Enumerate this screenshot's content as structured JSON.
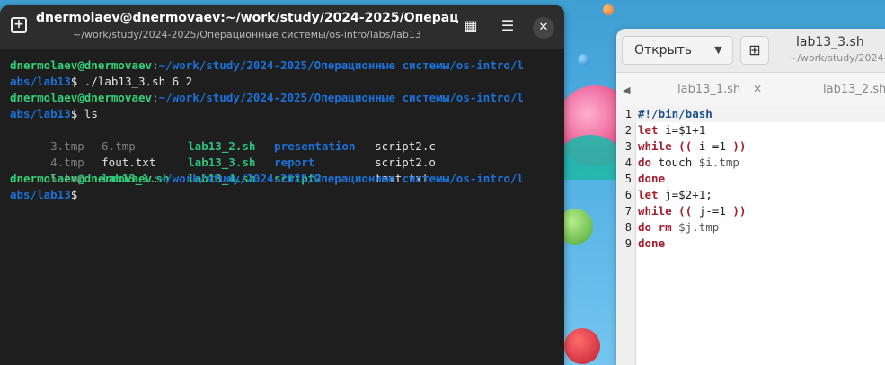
{
  "terminal": {
    "title": "dnermolaev@dnermovaev:~/work/study/2024-2025/Операц...",
    "subtitle": "~/work/study/2024-2025/Операционные системы/os-intro/labs/lab13",
    "prompt_user": "dnermolaev@dnermovaev",
    "prompt_path_1": "~/work/study/2024-2025/Операционные системы/os-intro/l",
    "prompt_path_2": "abs/lab13",
    "cmd1": " ./lab13_3.sh 6 2",
    "cmd2": " ls",
    "ls": {
      "r1": [
        "3.tmp",
        "6.tmp",
        "lab13_2.sh",
        "presentation",
        "script2.c"
      ],
      "r2": [
        "4.tmp",
        "fout.txt",
        "lab13_3.sh",
        "report",
        "script2.o"
      ],
      "r3": [
        "5.tmp",
        "lab13_1.sh",
        "lab13_4.sh",
        "script2",
        "text.txt"
      ]
    },
    "colors": {
      "background": "#1e1e1e",
      "prompt": "#33d17a",
      "executable": "#2ec27e",
      "directory": "#1c71d8"
    }
  },
  "editor": {
    "open_label": "Открыть",
    "title": "lab13_3.sh",
    "subtitle": "~/work/study/2024-",
    "tabs": [
      "lab13_1.sh",
      "lab13_2.sh"
    ],
    "line_numbers": [
      "1",
      "2",
      "3",
      "4",
      "5",
      "6",
      "7",
      "8",
      "9"
    ],
    "code": {
      "l1": "#!/bin/bash",
      "l2a": "let",
      "l2b": " i=$1+1",
      "l3a": "while",
      "l3b": " (( ",
      "l3c": "i-=1",
      "l3d": " ))",
      "l4a": "do",
      "l4b": " touch ",
      "l4c": "$i.tmp",
      "l5": "done",
      "l6a": "let",
      "l6b": " j=$2+1;",
      "l7a": "while",
      "l7b": " (( ",
      "l7c": "j-=1",
      "l7d": " ))",
      "l8a": "do",
      "l8b": " rm ",
      "l8c": "$j.tmp",
      "l9": "done"
    }
  }
}
